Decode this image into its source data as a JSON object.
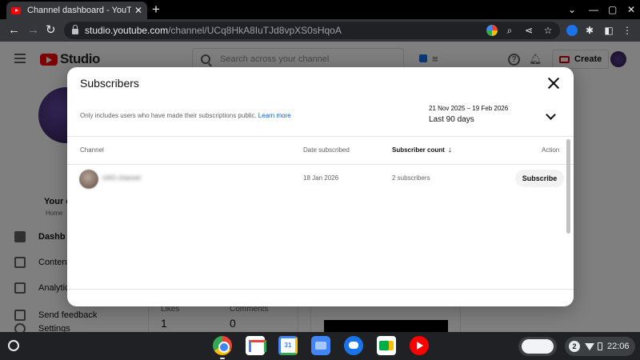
{
  "browser": {
    "tab_title": "Channel dashboard - YouTube St",
    "tab_close": "✕",
    "new_tab": "+",
    "url_host": "studio.youtube.com",
    "url_path": "/channel/UCq8HkA8IuTJd8vpXS0sHqoA",
    "controls": {
      "minimize": "⌄",
      "restore": "—",
      "maximize": "▢",
      "close": "✕"
    }
  },
  "studio": {
    "logo_text": "Studio",
    "search_placeholder": "Search across your channel",
    "create_label": "Create",
    "sidebar": {
      "channel_name": "Your c",
      "channel_sub": "Home",
      "items": [
        {
          "label": "Dashb"
        },
        {
          "label": "Content"
        },
        {
          "label": "Analytic"
        },
        {
          "label": "Settings"
        },
        {
          "label": "Send feedback"
        }
      ]
    },
    "stats": [
      {
        "label": "Likes",
        "value": "1"
      },
      {
        "label": "Comments",
        "value": "0"
      }
    ]
  },
  "modal": {
    "title": "Subscribers",
    "note": "Only includes users who have made their subscriptions public.",
    "learn_more": "Learn more",
    "range_dates": "21 Nov 2025 – 19 Feb 2026",
    "range_label": "Last 90 days",
    "columns": {
      "channel": "Channel",
      "date": "Date subscribed",
      "count": "Subscriber count",
      "action": "Action"
    },
    "rows": [
      {
        "channel_name": "UAG channel",
        "date": "18 Jan 2026",
        "subscribers": "2 subscribers",
        "action_label": "Subscribe"
      }
    ]
  },
  "shelf": {
    "calendar_day": "31",
    "notifications": "2",
    "time": "22:06"
  }
}
